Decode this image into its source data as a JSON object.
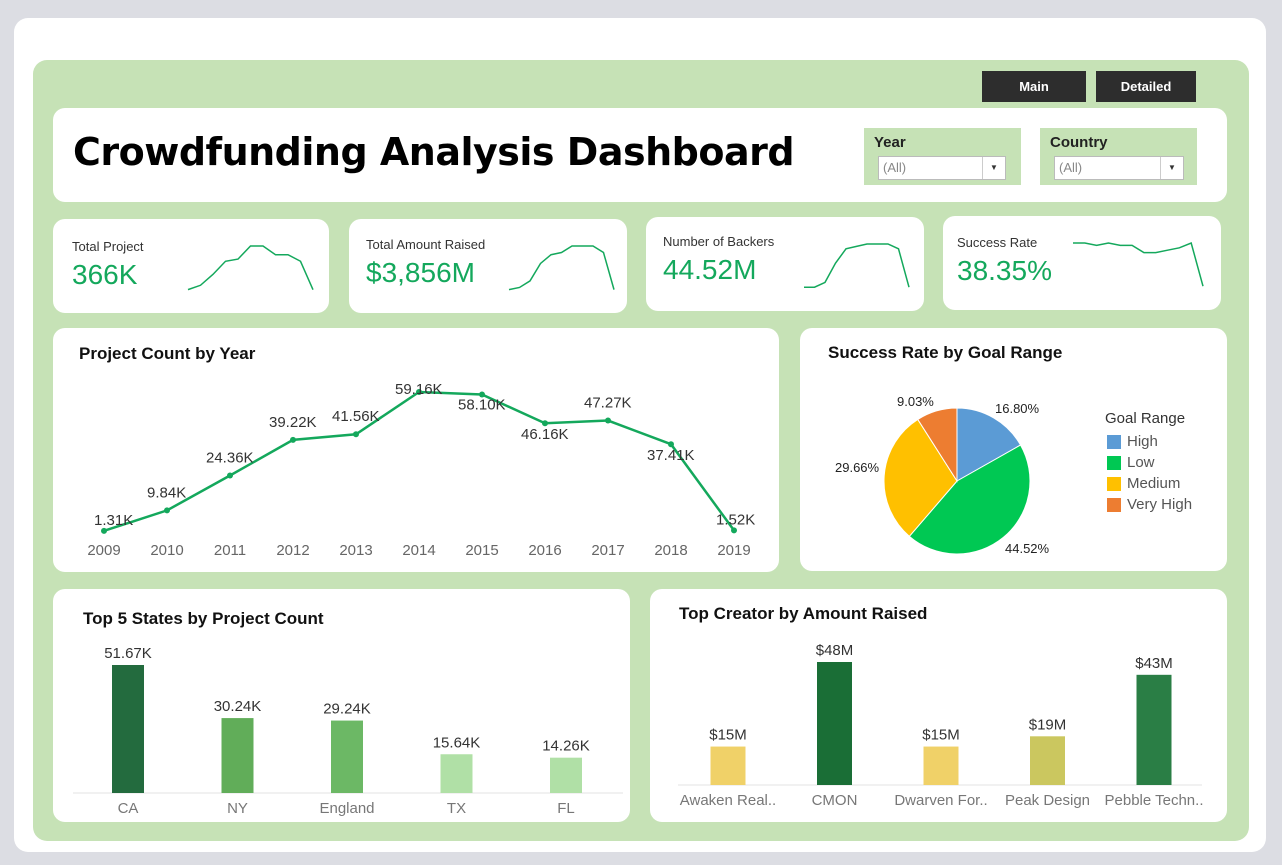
{
  "nav": {
    "main_label": "Main",
    "detailed_label": "Detailed"
  },
  "header": {
    "title": "Crowdfunding Analysis Dashboard"
  },
  "filters": {
    "year": {
      "label": "Year",
      "value": "(All)"
    },
    "country": {
      "label": "Country",
      "value": "(All)"
    }
  },
  "kpis": [
    {
      "label": "Total Project",
      "value": "366K"
    },
    {
      "label": "Total Amount Raised",
      "value": "$3,856M"
    },
    {
      "label": "Number of Backers",
      "value": "44.52M"
    },
    {
      "label": "Success Rate",
      "value": "38.35%"
    }
  ],
  "colors": {
    "accent_green": "#14a85c",
    "panel_green": "#c6e2b6",
    "nav_dark": "#2d2d2d"
  },
  "charts": {
    "project_by_year": {
      "title": "Project Count by Year"
    },
    "success_by_goal": {
      "title": "Success Rate by Goal Range",
      "legend_title": "Goal Range"
    },
    "top_states": {
      "title": "Top 5 States by Project Count"
    },
    "top_creators": {
      "title": "Top Creator by Amount Raised"
    }
  },
  "chart_data": [
    {
      "type": "line",
      "title": "Project Count by Year",
      "x": [
        "2009",
        "2010",
        "2011",
        "2012",
        "2013",
        "2014",
        "2015",
        "2016",
        "2017",
        "2018",
        "2019"
      ],
      "values": [
        1.31,
        9.84,
        24.36,
        39.22,
        41.56,
        59.16,
        58.1,
        46.16,
        47.27,
        37.41,
        1.52
      ],
      "labels": [
        "1.31K",
        "9.84K",
        "24.36K",
        "39.22K",
        "41.56K",
        "59.16K",
        "58.10K",
        "46.16K",
        "47.27K",
        "37.41K",
        "1.52K"
      ],
      "color": "#14a85c"
    },
    {
      "type": "pie",
      "title": "Success Rate by Goal Range",
      "legend_title": "Goal Range",
      "slices": [
        {
          "name": "High",
          "value": 16.8,
          "label": "16.80%",
          "color": "#5b9bd5"
        },
        {
          "name": "Low",
          "value": 44.52,
          "label": "44.52%",
          "color": "#00c853"
        },
        {
          "name": "Medium",
          "value": 29.66,
          "label": "29.66%",
          "color": "#ffc000"
        },
        {
          "name": "Very High",
          "value": 9.03,
          "label": "9.03%",
          "color": "#ed7d31"
        }
      ]
    },
    {
      "type": "bar",
      "title": "Top 5 States by Project Count",
      "categories": [
        "CA",
        "NY",
        "England",
        "TX",
        "FL"
      ],
      "values": [
        51.67,
        30.24,
        29.24,
        15.64,
        14.26
      ],
      "labels": [
        "51.67K",
        "30.24K",
        "29.24K",
        "15.64K",
        "14.26K"
      ],
      "colors": [
        "#236b3e",
        "#61ad59",
        "#6cb865",
        "#b0e0a6",
        "#b0e0a6"
      ]
    },
    {
      "type": "bar",
      "title": "Top Creator by Amount Raised",
      "categories": [
        "Awaken Real..",
        "CMON",
        "Dwarven For..",
        "Peak Design",
        "Pebble Techn.."
      ],
      "values": [
        15,
        48,
        15,
        19,
        43
      ],
      "labels": [
        "$15M",
        "$48M",
        "$15M",
        "$19M",
        "$43M"
      ],
      "colors": [
        "#f0d168",
        "#1a6e36",
        "#f0d168",
        "#cbc75f",
        "#2a7e45"
      ]
    }
  ],
  "sparklines": [
    [
      2,
      4,
      9,
      15,
      16,
      22,
      22,
      18,
      18,
      15,
      2
    ],
    [
      2,
      3,
      6,
      14,
      18,
      19,
      22,
      22,
      22,
      19,
      2
    ],
    [
      2,
      2,
      4,
      12,
      18,
      19,
      20,
      20,
      20,
      18,
      2
    ],
    [
      20,
      20,
      19,
      20,
      19,
      19,
      16,
      16,
      17,
      18,
      20,
      2
    ]
  ]
}
